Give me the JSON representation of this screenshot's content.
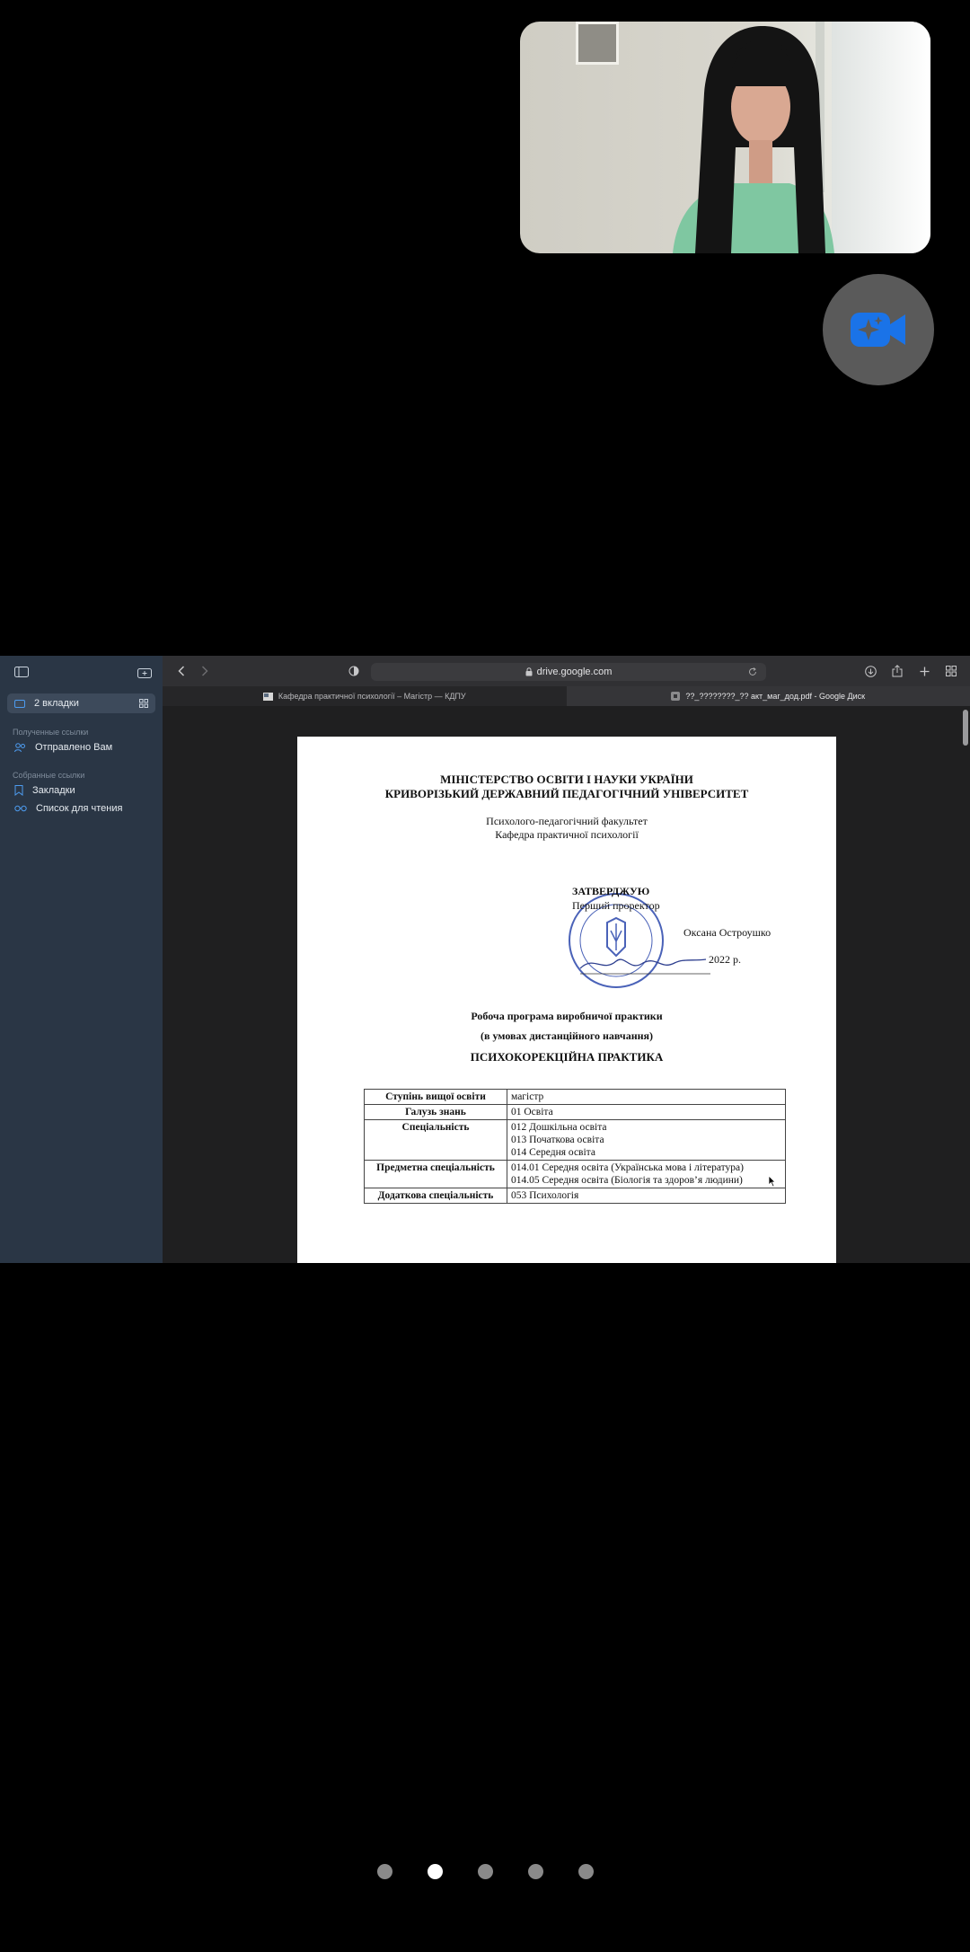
{
  "browser": {
    "sidebar": {
      "tabs_label": "2 вкладки",
      "section_received": "Полученные ссылки",
      "sent_to_you": "Отправлено Вам",
      "section_collections": "Собранные ссылки",
      "bookmarks": "Закладки",
      "reading_list": "Список для чтения"
    },
    "address": "drive.google.com",
    "tabs": [
      {
        "title": "Кафедра практичної психології – Магістр — КДПУ"
      },
      {
        "title": "??_????????_?? акт_маг_дод.pdf - Google Диск"
      }
    ]
  },
  "document": {
    "ministry": "МІНІСТЕРСТВО ОСВІТИ І НАУКИ УКРАЇНИ",
    "university": "КРИВОРІЗЬКИЙ ДЕРЖАВНИЙ ПЕДАГОГІЧНИЙ УНІВЕРСИТЕТ",
    "faculty": "Психолого-педагогічний факультет",
    "department": "Кафедра практичної психології",
    "approve": "ЗАТВЕРДЖУЮ",
    "approver_role": "Перший проректор",
    "approver_name": "Оксана Остроушко",
    "year": "2022 р.",
    "title_line1": "Робоча програма виробничої практики",
    "title_line2": "(в умовах дистанційного навчання)",
    "title_line3": "ПСИХОКОРЕКЦІЙНА ПРАКТИКА",
    "table": [
      {
        "key": "Ступінь вищої освіти",
        "values": [
          "магістр"
        ]
      },
      {
        "key": "Галузь знань",
        "values": [
          "01 Освіта"
        ]
      },
      {
        "key": "Спеціальність",
        "values": [
          "012 Дошкільна освіта",
          "013 Початкова освіта",
          "014 Середня освіта"
        ]
      },
      {
        "key": "Предметна спеціальність",
        "values": [
          "014.01 Середня освіта (Українська мова і література)",
          "014.05 Середня освіта (Біологія та здоров’я людини)"
        ]
      },
      {
        "key": "Додаткова спеціальність",
        "values": [
          "053 Психологія"
        ]
      }
    ]
  },
  "pager": {
    "count": 5,
    "active_index": 1
  },
  "colors": {
    "camera_icon": "#1a73e8",
    "sidebar_bg": "#2a3645"
  }
}
